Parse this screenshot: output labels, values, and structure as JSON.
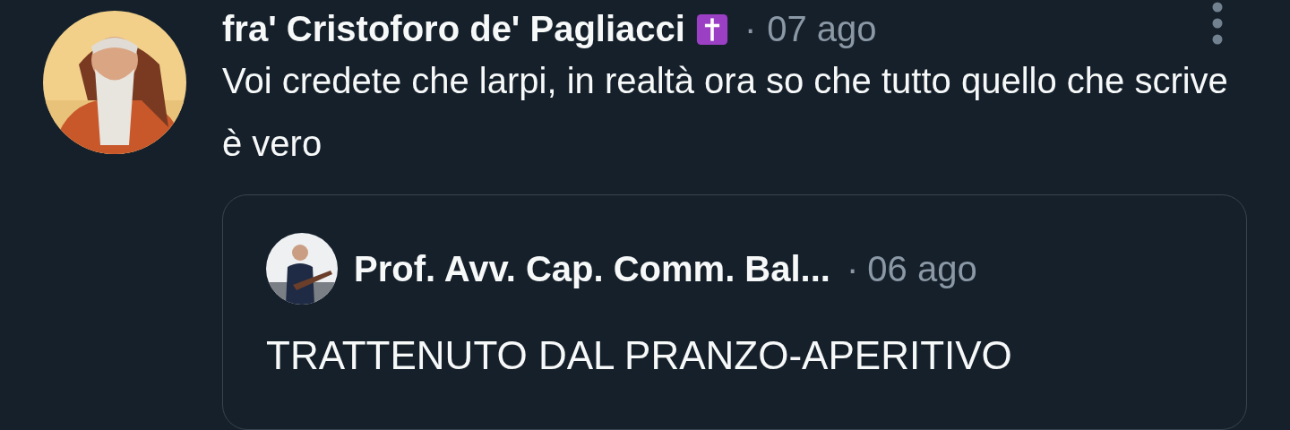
{
  "post": {
    "author": "fra' Cristoforo de' Pagliacci",
    "dot": "·",
    "time": "07 ago",
    "text": "Voi credete che larpi, in realtà ora so che tutto quello che scrive è vero",
    "quote": {
      "author": "Prof. Avv. Cap. Comm. Bal...",
      "dot": "·",
      "time": "06 ago",
      "text": "TRATTENUTO DAL PRANZO-APERITIVO"
    }
  }
}
